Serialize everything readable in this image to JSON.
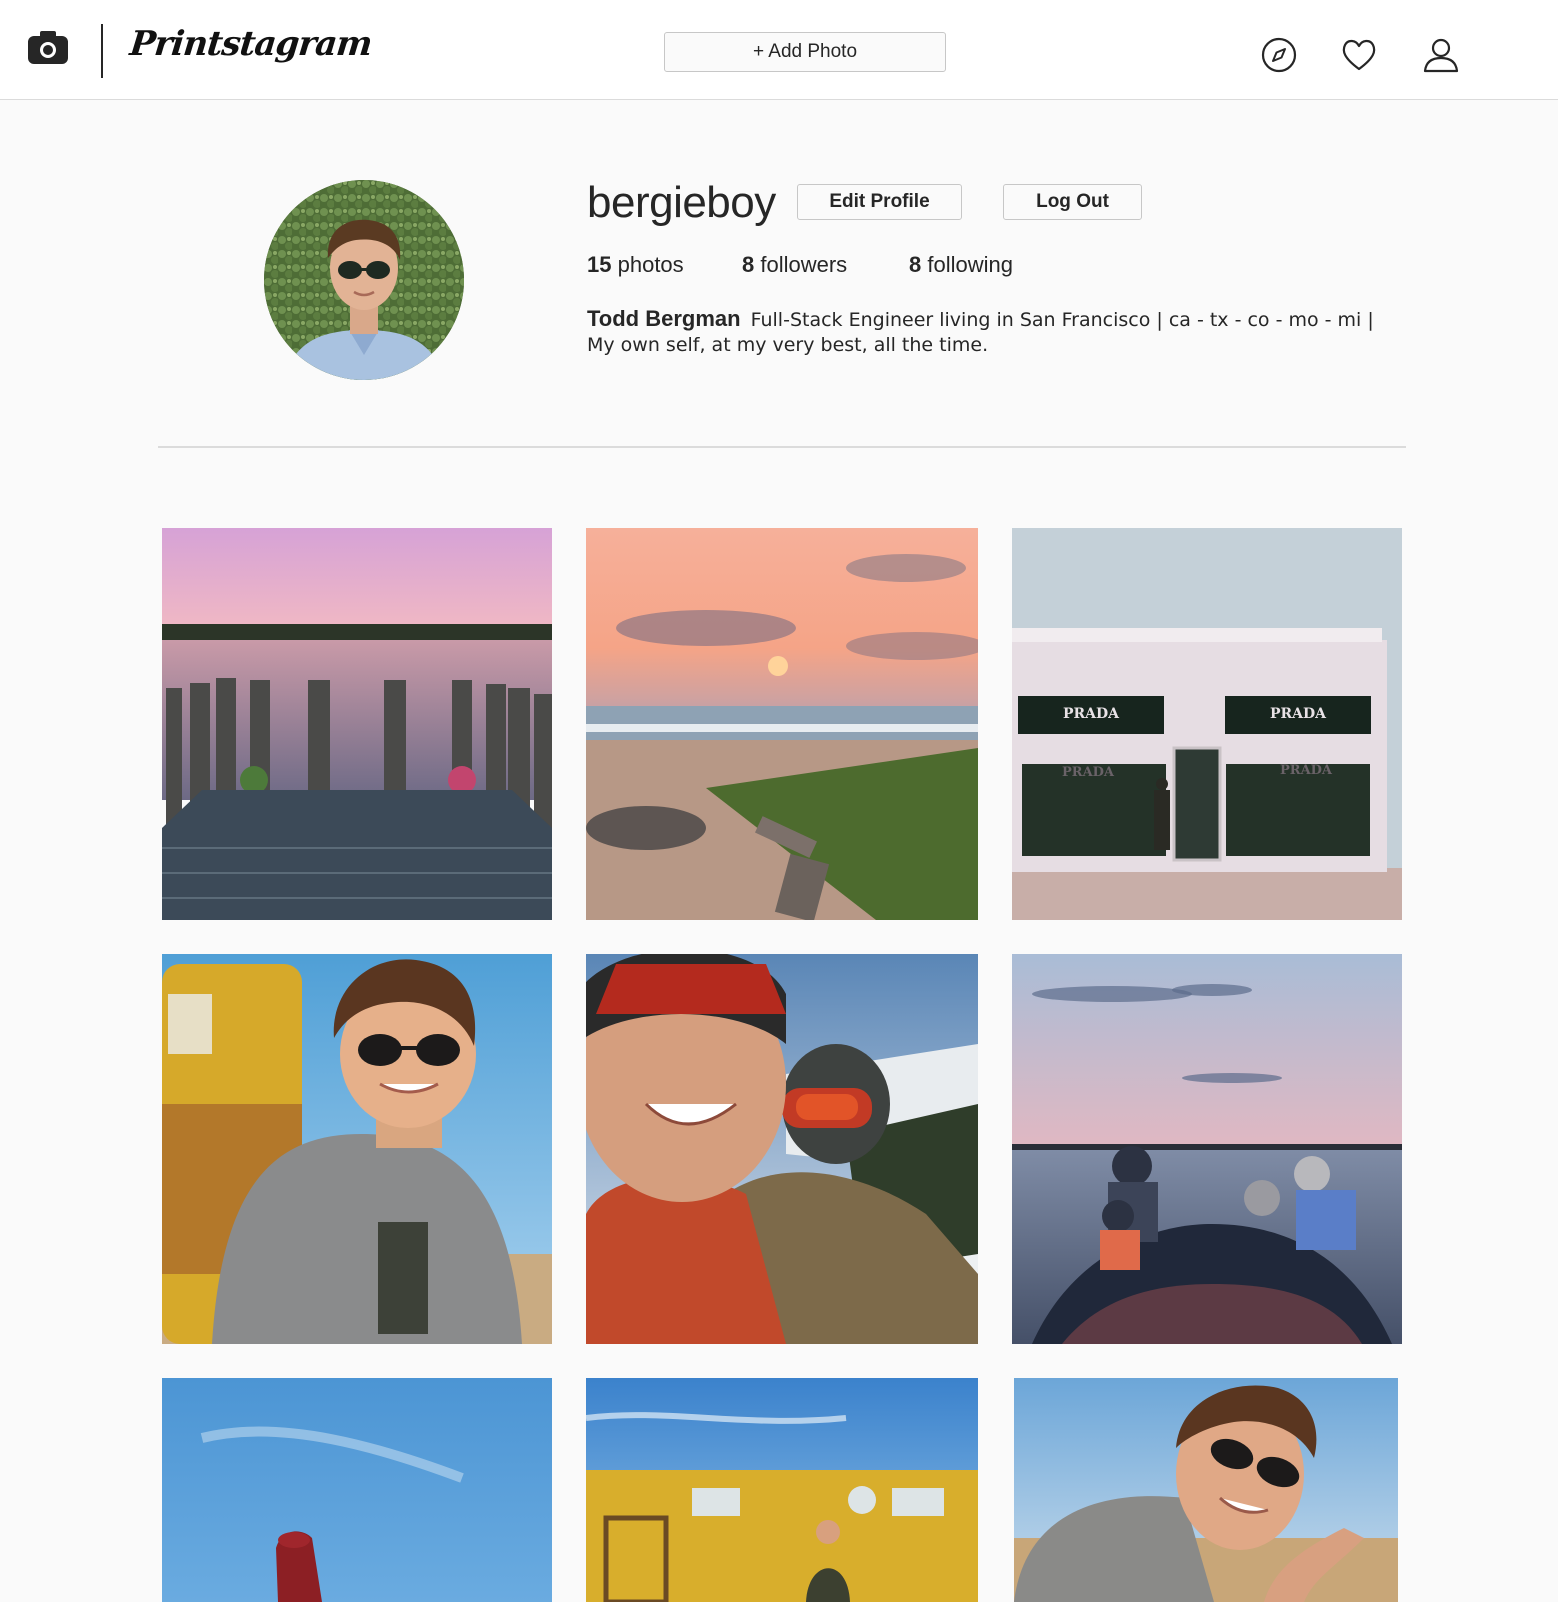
{
  "nav": {
    "logo_text": "Printstagram",
    "add_photo_label": "+ Add Photo",
    "icons": [
      "camera-icon",
      "compass-icon",
      "heart-icon",
      "user-icon"
    ]
  },
  "profile": {
    "username": "bergieboy",
    "edit_profile_label": "Edit Profile",
    "log_out_label": "Log Out",
    "stats": {
      "photos_count": "15",
      "photos_label": "photos",
      "followers_count": "8",
      "followers_label": "followers",
      "following_count": "8",
      "following_label": "following"
    },
    "full_name": "Todd Bergman",
    "bio": "Full-Stack Engineer living in San Francisco | ca - tx - co - mo - mi | My own self, at my very best, all the time."
  },
  "colors": {
    "background": "#fafafa",
    "nav_background": "#ffffff",
    "border": "#dbdbdb",
    "text": "#262626"
  }
}
